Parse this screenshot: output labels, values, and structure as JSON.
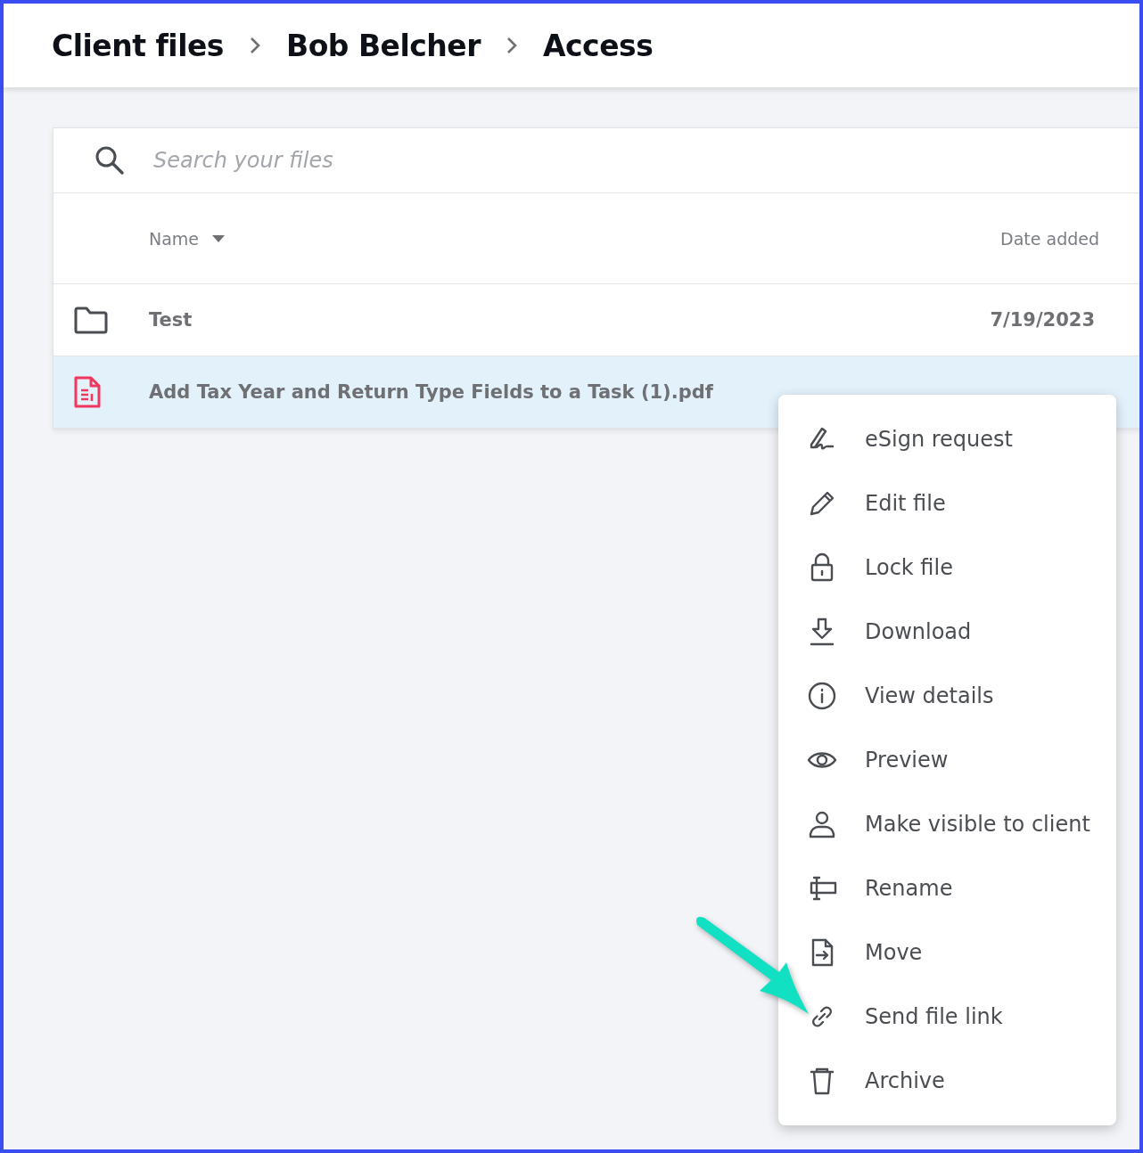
{
  "breadcrumbs": [
    {
      "label": "Client files"
    },
    {
      "label": "Bob Belcher"
    },
    {
      "label": "Access"
    }
  ],
  "search": {
    "placeholder": "Search your files"
  },
  "table": {
    "columns": [
      {
        "label": "Name",
        "sorted": true
      },
      {
        "label": "Date added",
        "sorted": false
      }
    ],
    "rows": [
      {
        "kind": "folder",
        "name": "Test",
        "date": "7/19/2023",
        "selected": false
      },
      {
        "kind": "pdf",
        "name": "Add Tax Year and Return Type Fields to a Task (1).pdf",
        "selected": true
      }
    ]
  },
  "context_menu": {
    "items": [
      {
        "label": "eSign request"
      },
      {
        "label": "Edit file"
      },
      {
        "label": "Lock file"
      },
      {
        "label": "Download"
      },
      {
        "label": "View details"
      },
      {
        "label": "Preview"
      },
      {
        "label": "Make visible to client"
      },
      {
        "label": "Rename"
      },
      {
        "label": "Move"
      },
      {
        "label": "Send file link"
      },
      {
        "label": "Archive"
      }
    ]
  }
}
